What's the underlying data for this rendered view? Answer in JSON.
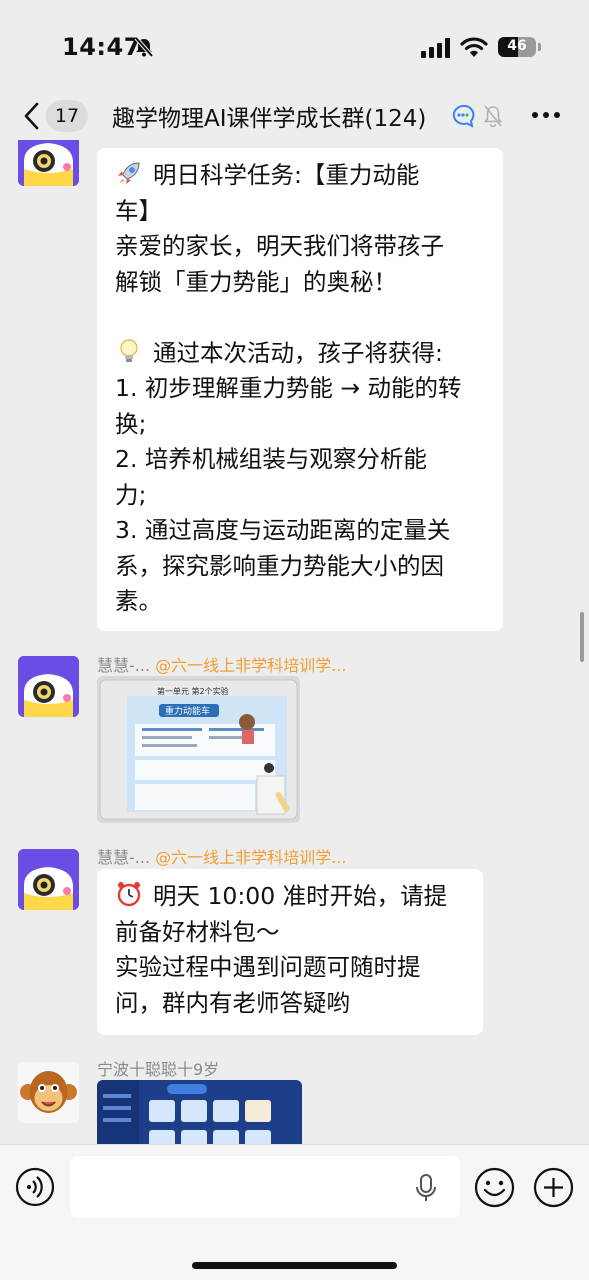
{
  "status_bar": {
    "time": "14:47",
    "battery": "46"
  },
  "nav": {
    "unread_count": "17",
    "title": "趣学物理AI课伴学成长群",
    "member_count": "(124)"
  },
  "messages": [
    {
      "type": "text",
      "lines": [
        "明日科学任务:【重力动能",
        "车】",
        "亲爱的家长，明天我们将带孩子",
        "解锁「重力势能」的奥秘！",
        "",
        "通过本次活动，孩子将获得:",
        "1. 初步理解重力势能 → 动能的转",
        "换;",
        "2. 培养机械组装与观察分析能",
        "力;",
        "3. 通过高度与运动距离的定量关",
        "系，探究影响重力势能大小的因",
        "素。"
      ]
    },
    {
      "type": "image",
      "sender": "慧慧-...",
      "mention": "@六一线上非学科培训学...",
      "image_text": {
        "header": "第一单元  第2个实验",
        "card_title": "重力动能车"
      }
    },
    {
      "type": "text",
      "sender": "慧慧-...",
      "mention": "@六一线上非学科培训学...",
      "lines": [
        "明天 10:00 准时开始，请提",
        "前备好材料包～",
        "实验过程中遇到问题可随时提",
        "问，群内有老师答疑哟"
      ]
    },
    {
      "type": "image",
      "sender": "宁波十聪聪十9岁"
    }
  ],
  "icons": {
    "back": "chevron-left-icon",
    "ai": "chat-ai-icon",
    "mute": "bell-off-icon",
    "more": "more-dots-icon",
    "voice": "voice-icon",
    "mic": "microphone-icon",
    "emoji": "smiley-icon",
    "plus": "plus-icon",
    "rocket": "rocket-icon",
    "bulb": "light-bulb-icon",
    "clock": "alarm-clock-icon"
  }
}
